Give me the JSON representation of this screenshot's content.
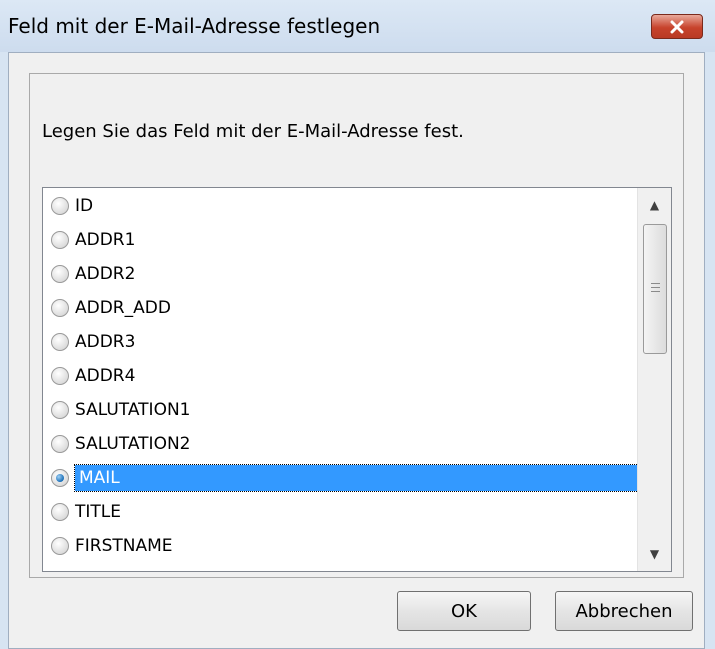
{
  "dialog": {
    "title": "Feld mit der E-Mail-Adresse festlegen",
    "prompt": "Legen Sie das Feld mit der E-Mail-Adresse fest.",
    "accent_color": "#3399ff",
    "close_icon": "close-icon"
  },
  "fields": [
    {
      "label": "ID",
      "checked": false
    },
    {
      "label": "ADDR1",
      "checked": false
    },
    {
      "label": "ADDR2",
      "checked": false
    },
    {
      "label": "ADDR_ADD",
      "checked": false
    },
    {
      "label": "ADDR3",
      "checked": false
    },
    {
      "label": "ADDR4",
      "checked": false
    },
    {
      "label": "SALUTATION1",
      "checked": false
    },
    {
      "label": "SALUTATION2",
      "checked": false
    },
    {
      "label": "MAIL",
      "checked": true
    },
    {
      "label": "TITLE",
      "checked": false
    },
    {
      "label": "FIRSTNAME",
      "checked": false
    }
  ],
  "buttons": {
    "ok": "OK",
    "cancel": "Abbrechen"
  }
}
